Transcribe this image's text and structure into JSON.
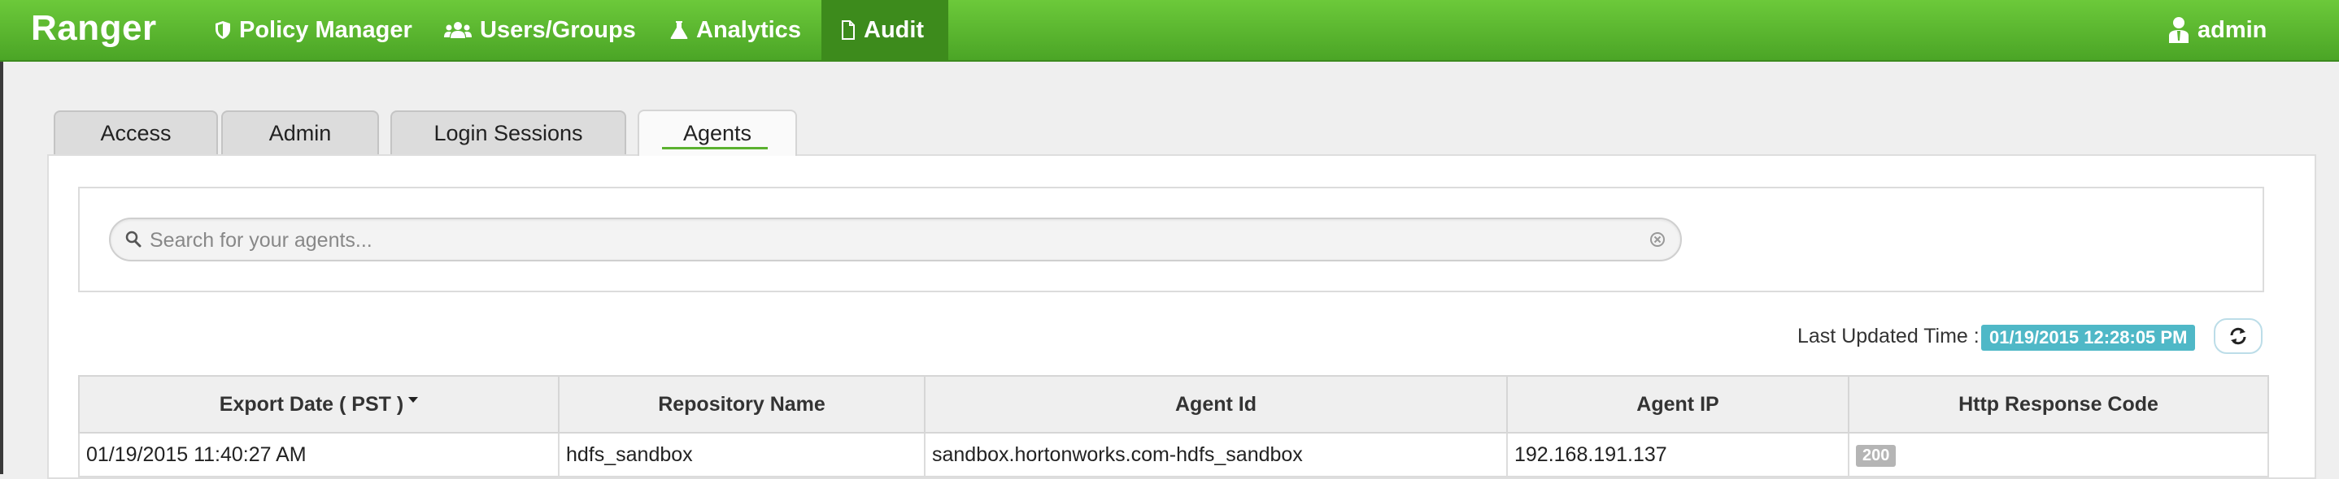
{
  "navbar": {
    "brand": "Ranger",
    "items": [
      {
        "label": "Policy Manager",
        "icon": "shield-icon"
      },
      {
        "label": "Users/Groups",
        "icon": "users-icon"
      },
      {
        "label": "Analytics",
        "icon": "flask-icon"
      },
      {
        "label": "Audit",
        "icon": "file-icon",
        "active": true
      }
    ],
    "user": {
      "label": "admin",
      "icon": "user-icon"
    },
    "colors": {
      "bar": "#5cb832",
      "active": "#3d8b1c"
    }
  },
  "tabs": [
    {
      "label": "Access"
    },
    {
      "label": "Admin"
    },
    {
      "label": "Login Sessions"
    },
    {
      "label": "Agents",
      "active": true
    }
  ],
  "search": {
    "placeholder": "Search for your agents...",
    "value": ""
  },
  "last_updated": {
    "label": "Last Updated Time :",
    "value": "01/19/2015 12:28:05 PM"
  },
  "table": {
    "columns": [
      "Export Date ( PST )",
      "Repository Name",
      "Agent Id",
      "Agent IP",
      "Http Response Code"
    ],
    "rows": [
      {
        "export_date": "01/19/2015 11:40:27 AM",
        "repository": "hdfs_sandbox",
        "agent_id": "sandbox.hortonworks.com-hdfs_sandbox",
        "agent_ip": "192.168.191.137",
        "http_code": "200"
      }
    ]
  }
}
